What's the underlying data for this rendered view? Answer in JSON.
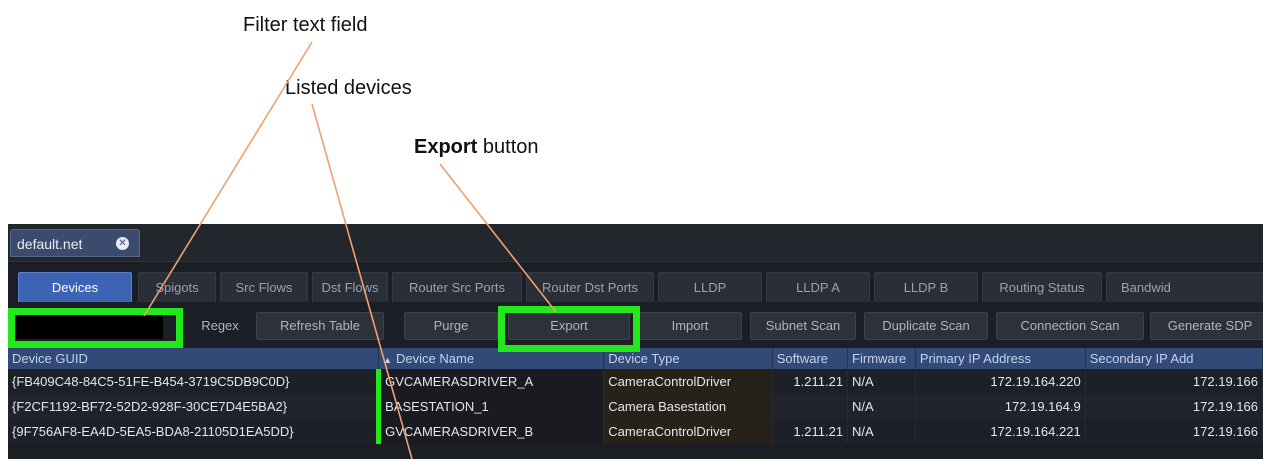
{
  "callouts": {
    "filter": "Filter text field",
    "devices": "Listed devices",
    "export_bold": "Export",
    "export_rest": " button"
  },
  "colors": {
    "highlight": "#22e81c",
    "leader": "#f0a070",
    "active_tab": "#3d64b4",
    "header": "#324a78"
  },
  "doc_tab": {
    "label": "default.net",
    "close_icon": "close-circle-icon"
  },
  "tabs": [
    "Devices",
    "Spigots",
    "Src Flows",
    "Dst Flows",
    "Router Src Ports",
    "Router Dst Ports",
    "LLDP",
    "LLDP A",
    "LLDP B",
    "Routing Status",
    "Bandwid"
  ],
  "toolbar": {
    "filter_value": "",
    "regex": "Regex",
    "refresh": "Refresh Table",
    "purge": "Purge",
    "export": "Export",
    "import": "Import",
    "subnet_scan": "Subnet Scan",
    "duplicate_scan": "Duplicate Scan",
    "connection_scan": "Connection Scan",
    "generate_sdp": "Generate SDP"
  },
  "table": {
    "columns": [
      "Device GUID",
      "Device Name",
      "Device Type",
      "Software",
      "Firmware",
      "Primary IP Address",
      "Secondary IP Add"
    ],
    "sorted_column_icon": "sort-ascending-icon",
    "rows": [
      [
        "{FB409C48-84C5-51FE-B454-3719C5DB9C0D}",
        "GVCAMERASDRIVER_A",
        "CameraControlDriver",
        "1.211.21",
        "N/A",
        "172.19.164.220",
        "172.19.166"
      ],
      [
        "{F2CF1192-BF72-52D2-928F-30CE7D4E5BA2}",
        "BASESTATION_1",
        "Camera Basestation",
        "",
        "N/A",
        "172.19.164.9",
        "172.19.166"
      ],
      [
        "{9F756AF8-EA4D-5EA5-BDA8-21105D1EA5DD}",
        "GVCAMERASDRIVER_B",
        "CameraControlDriver",
        "1.211.21",
        "N/A",
        "172.19.164.221",
        "172.19.166"
      ]
    ]
  }
}
